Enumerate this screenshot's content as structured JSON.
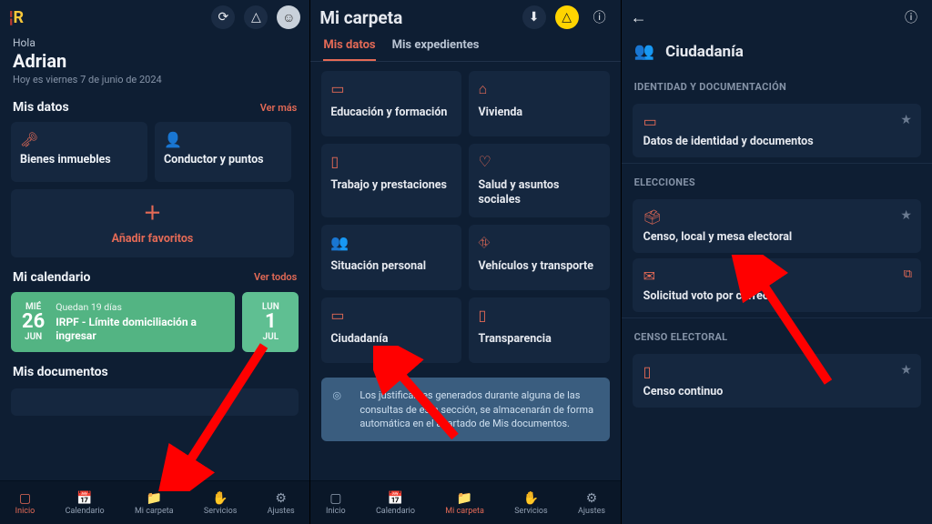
{
  "pane1": {
    "greeting_hola": "Hola",
    "greeting_name": "Adrian",
    "greeting_date": "Hoy es viernes 7 de junio de 2024",
    "misdatos_title": "Mis datos",
    "vermas": "Ver más",
    "tiles": [
      {
        "icon": "key-icon",
        "label": "Bienes inmuebles"
      },
      {
        "icon": "person-icon",
        "label": "Conductor y puntos"
      }
    ],
    "add_label": "Añadir favoritos",
    "micalendario_title": "Mi calendario",
    "vertodos": "Ver todos",
    "cal1": {
      "dow": "MIÉ",
      "day": "26",
      "mon": "JUN",
      "sub": "Quedan 19 días",
      "title": "IRPF - Límite domiciliación a ingresar"
    },
    "cal2": {
      "dow": "LUN",
      "day": "1",
      "mon": "JUL"
    },
    "misdoc_title": "Mis documentos"
  },
  "pane2": {
    "title": "Mi carpeta",
    "tab1": "Mis datos",
    "tab2": "Mis expedientes",
    "cats": [
      {
        "icon": "book-icon",
        "label": "Educación y formación"
      },
      {
        "icon": "home-icon",
        "label": "Vivienda"
      },
      {
        "icon": "briefcase-icon",
        "label": "Trabajo y prestaciones"
      },
      {
        "icon": "heart-icon",
        "label": "Salud y asuntos sociales"
      },
      {
        "icon": "people-icon",
        "label": "Situación personal"
      },
      {
        "icon": "road-icon",
        "label": "Vehículos y transporte"
      },
      {
        "icon": "id-icon",
        "label": "Ciudadanía"
      },
      {
        "icon": "doc-icon",
        "label": "Transparencia"
      }
    ],
    "info": "Los justificantes generados durante alguna de las consultas de esta sección, se almacenarán de forma automática en el apartado de Mis documentos."
  },
  "pane3": {
    "title": "Ciudadanía",
    "sec1": "IDENTIDAD Y DOCUMENTACIÓN",
    "row1": "Datos de identidad y documentos",
    "sec2": "ELECCIONES",
    "row2": "Censo, local y mesa electoral",
    "row3": "Solicitud voto por correo",
    "sec3": "CENSO ELECTORAL",
    "row4": "Censo continuo"
  },
  "tabbar": {
    "inicio": "Inicio",
    "calendario": "Calendario",
    "micarpeta": "Mi carpeta",
    "servicios": "Servicios",
    "ajustes": "Ajustes"
  }
}
